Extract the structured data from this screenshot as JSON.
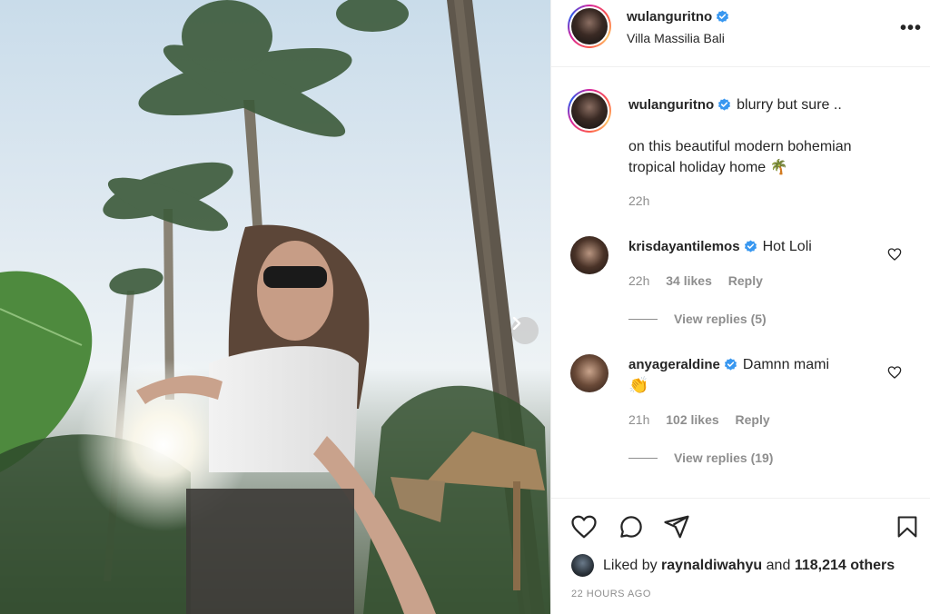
{
  "post": {
    "author": "wulanguritno",
    "location": "Villa Massilia Bali",
    "caption_first": "blurry but sure ..",
    "caption_body": "on this beautiful modern bohemian tropical holiday home 🌴",
    "caption_time": "22h"
  },
  "comments": [
    {
      "username": "krisdayantilemos",
      "text": "Hot Loli",
      "time": "22h",
      "likes": "34 likes",
      "reply": "Reply",
      "view_replies": "View replies (5)"
    },
    {
      "username": "anyageraldine",
      "text": "Damnn mami",
      "emoji": "👏",
      "time": "21h",
      "likes": "102 likes",
      "reply": "Reply",
      "view_replies": "View replies (19)"
    }
  ],
  "footer": {
    "liked_by_prefix": "Liked by",
    "liked_by_user": "raynaldiwahyu",
    "liked_by_and": "and",
    "liked_by_others": "118,214 others",
    "timestamp": "22 HOURS AGO"
  },
  "icons": {
    "more": "more-options-icon",
    "verified": "verified-badge-icon",
    "like": "heart-icon",
    "comment": "comment-icon",
    "share": "share-icon",
    "save": "bookmark-icon",
    "next": "chevron-right-icon"
  },
  "colors": {
    "verified_blue": "#3897f0",
    "text": "#262626",
    "muted": "#8e8e8e"
  }
}
